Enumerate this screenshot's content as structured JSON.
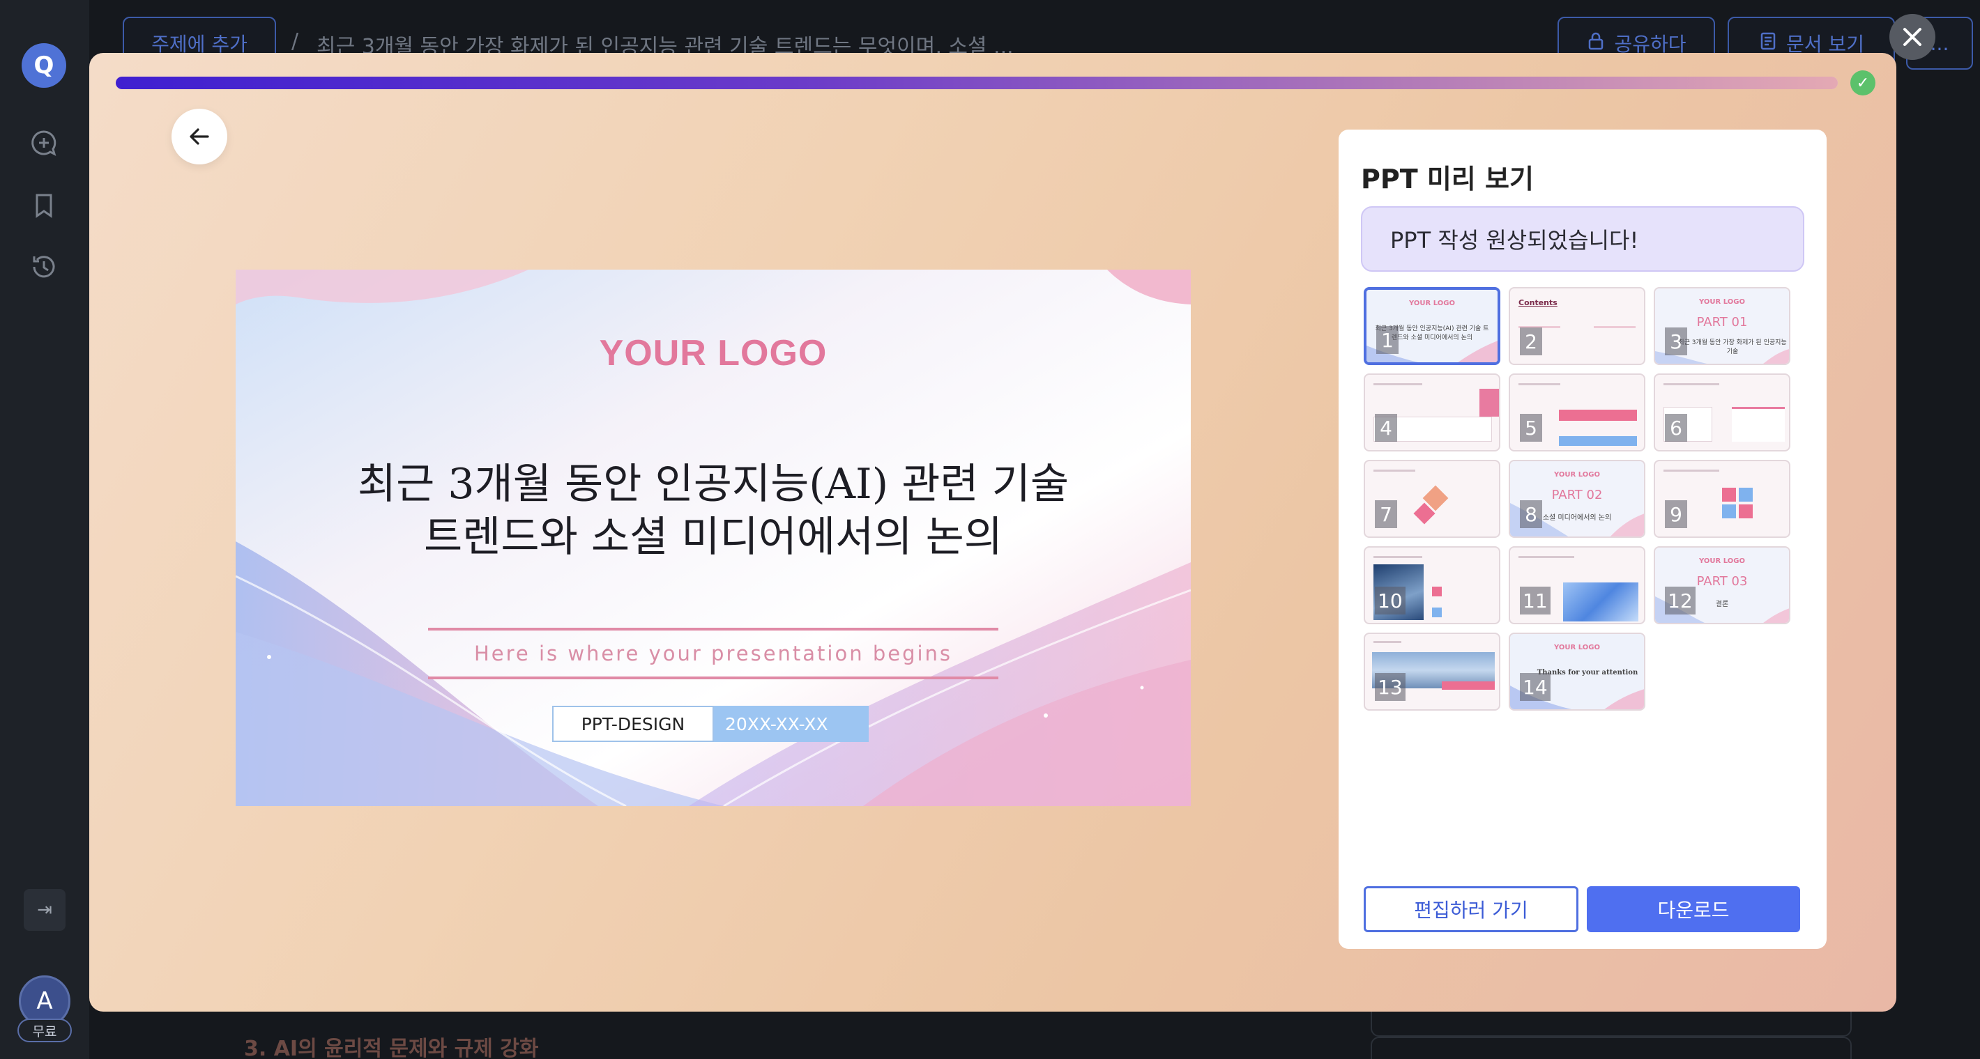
{
  "sidebar": {
    "logo_letter": "Q",
    "avatar_letter": "A",
    "plan_badge": "무료"
  },
  "topbar": {
    "add_topic": "주제에 추가",
    "separator": "/",
    "breadcrumb": "최근 3개월 동안 가장 화제가 된 인공지능 관련 기술 트렌드는 무엇이며, 소셜 ...",
    "share": "공유하다",
    "view_doc": "문서 보기",
    "more": "..."
  },
  "background": {
    "heading": "3. AI의 윤리적 문제와 규제 강화"
  },
  "modal": {
    "progress_percent": 100
  },
  "slide": {
    "logo": "YOUR LOGO",
    "title": "최근 3개월 동안 인공지능(AI) 관련 기술 트렌드와 소셜 미디어에서의 논의",
    "subtitle": "Here is where your presentation begins",
    "tag_left": "PPT-DESIGN",
    "tag_right": "20XX-XX-XX"
  },
  "panel": {
    "title": "PPT 미리 보기",
    "status": "PPT 작성 원상되었습니다!",
    "edit_button": "편집하러 가기",
    "download_button": "다운로드",
    "thumbnails": [
      {
        "num": "1",
        "logo": "YOUR LOGO",
        "caption": "최근 3개월 동안 인공지능(AI) 관련 기술 트렌드와 소셜 미디어에서의 논의"
      },
      {
        "num": "2",
        "head": "Contents"
      },
      {
        "num": "3",
        "logo": "YOUR LOGO",
        "part": "PART 01",
        "caption": "최근 3개월 동안 가장 화제가 된 인공지능 기술"
      },
      {
        "num": "4"
      },
      {
        "num": "5"
      },
      {
        "num": "6"
      },
      {
        "num": "7"
      },
      {
        "num": "8",
        "logo": "YOUR LOGO",
        "part": "PART 02",
        "caption": "소셜 미디어에서의 논의"
      },
      {
        "num": "9"
      },
      {
        "num": "10"
      },
      {
        "num": "11"
      },
      {
        "num": "12",
        "logo": "YOUR LOGO",
        "part": "PART 03",
        "caption": "결론"
      },
      {
        "num": "13"
      },
      {
        "num": "14",
        "logo": "YOUR LOGO",
        "caption": "Thanks for your attention"
      }
    ]
  }
}
